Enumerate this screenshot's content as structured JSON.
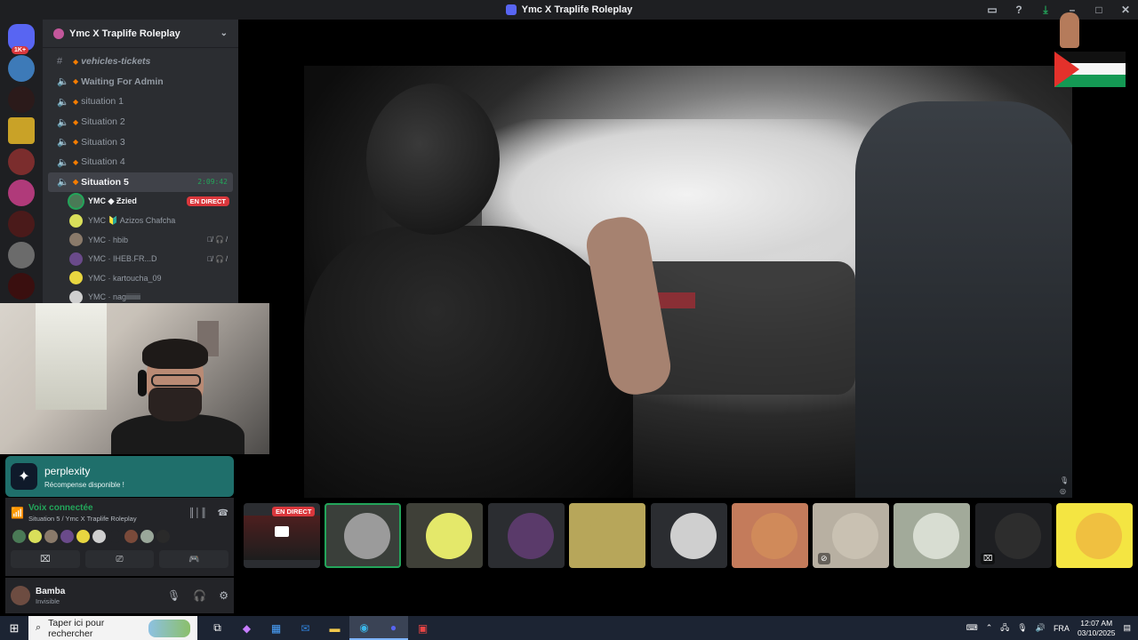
{
  "window": {
    "title": "Ymc X Traplife Roleplay"
  },
  "guilds": {
    "badge": "1K+"
  },
  "server": {
    "name": "Ymc X Traplife Roleplay",
    "channels": [
      {
        "name": "vehicles-tickets",
        "type": "text"
      },
      {
        "name": "Waiting For Admin",
        "type": "voice"
      },
      {
        "name": "situation 1",
        "type": "voice"
      },
      {
        "name": "Situation 2",
        "type": "voice"
      },
      {
        "name": "Situation 3",
        "type": "voice"
      },
      {
        "name": "Situation 4",
        "type": "voice"
      },
      {
        "name": "Situation 5",
        "type": "voice",
        "active": true,
        "timer": "2:09:42"
      }
    ],
    "voice_users": [
      {
        "name": "YMC ◆ Ƶzied",
        "live": "EN DIRECT"
      },
      {
        "name": "YMC 🔰 Azizos Chafcha"
      },
      {
        "name": "YMC · hbib"
      },
      {
        "name": "YMC · IHEB.FR...D"
      },
      {
        "name": "YMC · kartoucha_09"
      },
      {
        "name": "YMC · nagiiiiiiii"
      }
    ]
  },
  "promo": {
    "title": "perplexity",
    "subtitle": "Récompense disponible !"
  },
  "voice_panel": {
    "status": "Voix connectée",
    "location": "Situation 5 / Ymc X Traplife Roleplay"
  },
  "user": {
    "name": "Bamba",
    "status": "Invisible"
  },
  "stage_tiles": {
    "live_label": "EN DIRECT"
  },
  "taskbar": {
    "search_placeholder": "Taper ici pour rechercher",
    "language": "FRA",
    "time": "12:07 AM",
    "date": "03/10/2025"
  },
  "colors": {
    "accent_green": "#23a55a",
    "live_red": "#da373c",
    "promo_teal": "#1f6f6b",
    "sidebar": "#2b2d31"
  }
}
